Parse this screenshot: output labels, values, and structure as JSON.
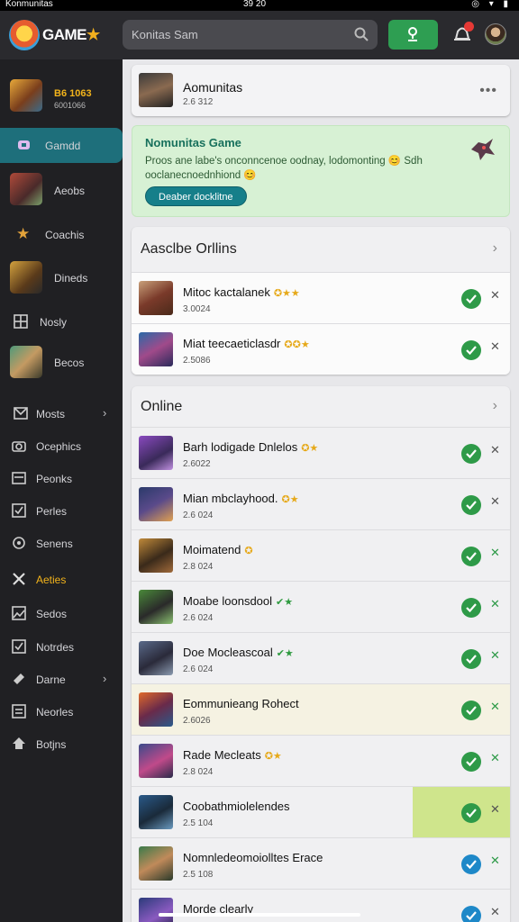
{
  "status_bar": {
    "left": "Konmunitas",
    "time": "39 20"
  },
  "app": {
    "logo_text": "GAME",
    "logo_star": "★"
  },
  "search": {
    "placeholder": "Konitas Sam"
  },
  "colors": {
    "accent_teal": "#1e6f7b",
    "accept_green": "#2e9a48",
    "promo_bg": "#d7f1d4",
    "accent_orange": "#f2b31b"
  },
  "sidebar": {
    "profile": {
      "line1": "B6 1063",
      "line2": "6001066"
    },
    "items": [
      {
        "label": "Gamdd",
        "icon": "controller-icon",
        "active": true
      },
      {
        "label": "Aeobs",
        "icon": "game-avatar"
      },
      {
        "label": "Coachis",
        "icon": "star-icon"
      },
      {
        "label": "Dineds",
        "icon": "game-avatar"
      },
      {
        "label": "Nosly",
        "icon": "grid-icon"
      },
      {
        "label": "Becos",
        "icon": "game-avatar"
      },
      {
        "label": "Mosts",
        "icon": "mail-icon",
        "chevron": "›"
      },
      {
        "label": "Ocephics",
        "icon": "camera-icon"
      },
      {
        "label": "Peonks",
        "icon": "cards-icon"
      },
      {
        "label": "Perles",
        "icon": "check-icon"
      },
      {
        "label": "Senens",
        "icon": "settings-icon"
      },
      {
        "label": "Aeties",
        "icon": "crossed-swords-icon",
        "accent": true
      },
      {
        "label": "Sedos",
        "icon": "image-icon"
      },
      {
        "label": "Notrdes",
        "icon": "check-icon"
      },
      {
        "label": "Darne",
        "icon": "tag-icon",
        "chevron": "›"
      },
      {
        "label": "Neorles",
        "icon": "note-icon"
      },
      {
        "label": "Botjns",
        "icon": "house-icon"
      }
    ]
  },
  "community": {
    "title": "Aomunitas",
    "sub": "2.6 312",
    "more": "•••"
  },
  "promo": {
    "title": "Nomunitas Game",
    "desc": "Proos ane labe's onconncenoe oodnay, lodomonting 😊 Sdh ooclanecnoednhiond 😊",
    "button": "Deaber docklitne"
  },
  "section1": {
    "title": "Aasclbe Orllins",
    "chevron": "›",
    "rows": [
      {
        "title": "Mitoc kactalanek",
        "stars": "✪★★",
        "sub": "3.0024"
      },
      {
        "title": "Miat teecaeticlasdr",
        "stars": "✪✪★",
        "sub": "2.5086"
      }
    ]
  },
  "section2": {
    "title": "Online",
    "chevron": "›",
    "rows": [
      {
        "title": "Barh lodigade Dnlelos",
        "stars": "✪★",
        "sub": "2.6022",
        "check": "green",
        "x": "grey"
      },
      {
        "title": "Mian mbclayhood.",
        "stars": "✪★",
        "sub": "2.6 024",
        "check": "green",
        "x": "grey"
      },
      {
        "title": "Moimatend",
        "stars": "✪",
        "sub": "2.8 024",
        "check": "green",
        "x": "green"
      },
      {
        "title": "Moabe loonsdool",
        "stars": "✔★",
        "sub": "2.6 024",
        "check": "green",
        "x": "green",
        "star_color": "green"
      },
      {
        "title": "Doe Mocleascoal",
        "stars": "✔★",
        "sub": "2.6 024",
        "check": "green",
        "x": "green",
        "star_color": "green"
      },
      {
        "title": "Eommunieang Rohect",
        "stars": "",
        "sub": "2.6026",
        "check": "green",
        "x": "green",
        "highlight": true
      },
      {
        "title": "Rade Mecleats",
        "stars": "✪★",
        "sub": "2.8 024",
        "check": "green",
        "x": "green"
      },
      {
        "title": "Coobathmiolelendes",
        "stars": "",
        "sub": "2.5 104",
        "check": "green",
        "x": "grey",
        "lime": true
      },
      {
        "title": "Nomnledeomoiolltes Erace",
        "stars": "",
        "sub": "2.5 108",
        "check": "blue",
        "x": "green"
      },
      {
        "title": "Morde clearly",
        "stars": "",
        "sub": "",
        "check": "blue",
        "x": "grey"
      }
    ]
  }
}
